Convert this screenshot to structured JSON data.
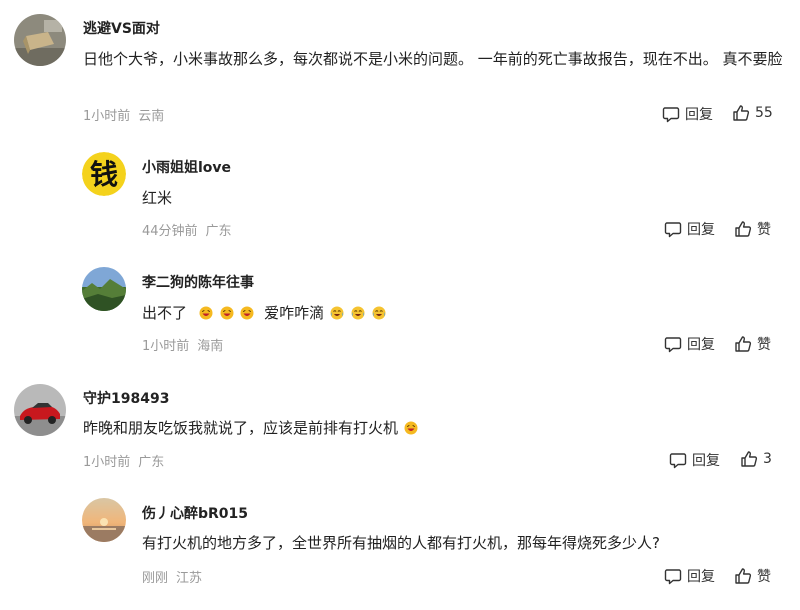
{
  "comments": [
    {
      "username": "逃避VS面对",
      "text": "日他个大爷，小米事故那么多，每次都说不是小米的问题。 一年前的死亡事故报告，现在不出。 真不要脸",
      "time": "1小时前",
      "location": "云南",
      "reply_label": "回复",
      "like_label": "55",
      "avatar_icon": "box-photo-avatar"
    },
    {
      "username": "小雨姐姐love",
      "text": "红米",
      "time": "44分钟前",
      "location": "广东",
      "reply_label": "回复",
      "like_label": "赞",
      "avatar_icon": "qian-character-avatar",
      "avatar_text": "钱"
    },
    {
      "username": "李二狗的陈年往事",
      "text_before": "出不了",
      "text_middle": "爱咋咋滴",
      "time": "1小时前",
      "location": "海南",
      "reply_label": "回复",
      "like_label": "赞",
      "avatar_icon": "landscape-avatar"
    },
    {
      "username": "守护198493",
      "text": "昨晚和朋友吃饭我就说了，应该是前排有打火机",
      "time": "1小时前",
      "location": "广东",
      "reply_label": "回复",
      "like_label": "3",
      "avatar_icon": "red-car-avatar"
    },
    {
      "username": "伤丿心醉bR015",
      "text": "有打火机的地方多了，全世界所有抽烟的人都有打火机，那每年得烧死多少人?",
      "time": "刚刚",
      "location": "江苏",
      "reply_label": "回复",
      "like_label": "赞",
      "avatar_icon": "sunset-avatar"
    }
  ]
}
